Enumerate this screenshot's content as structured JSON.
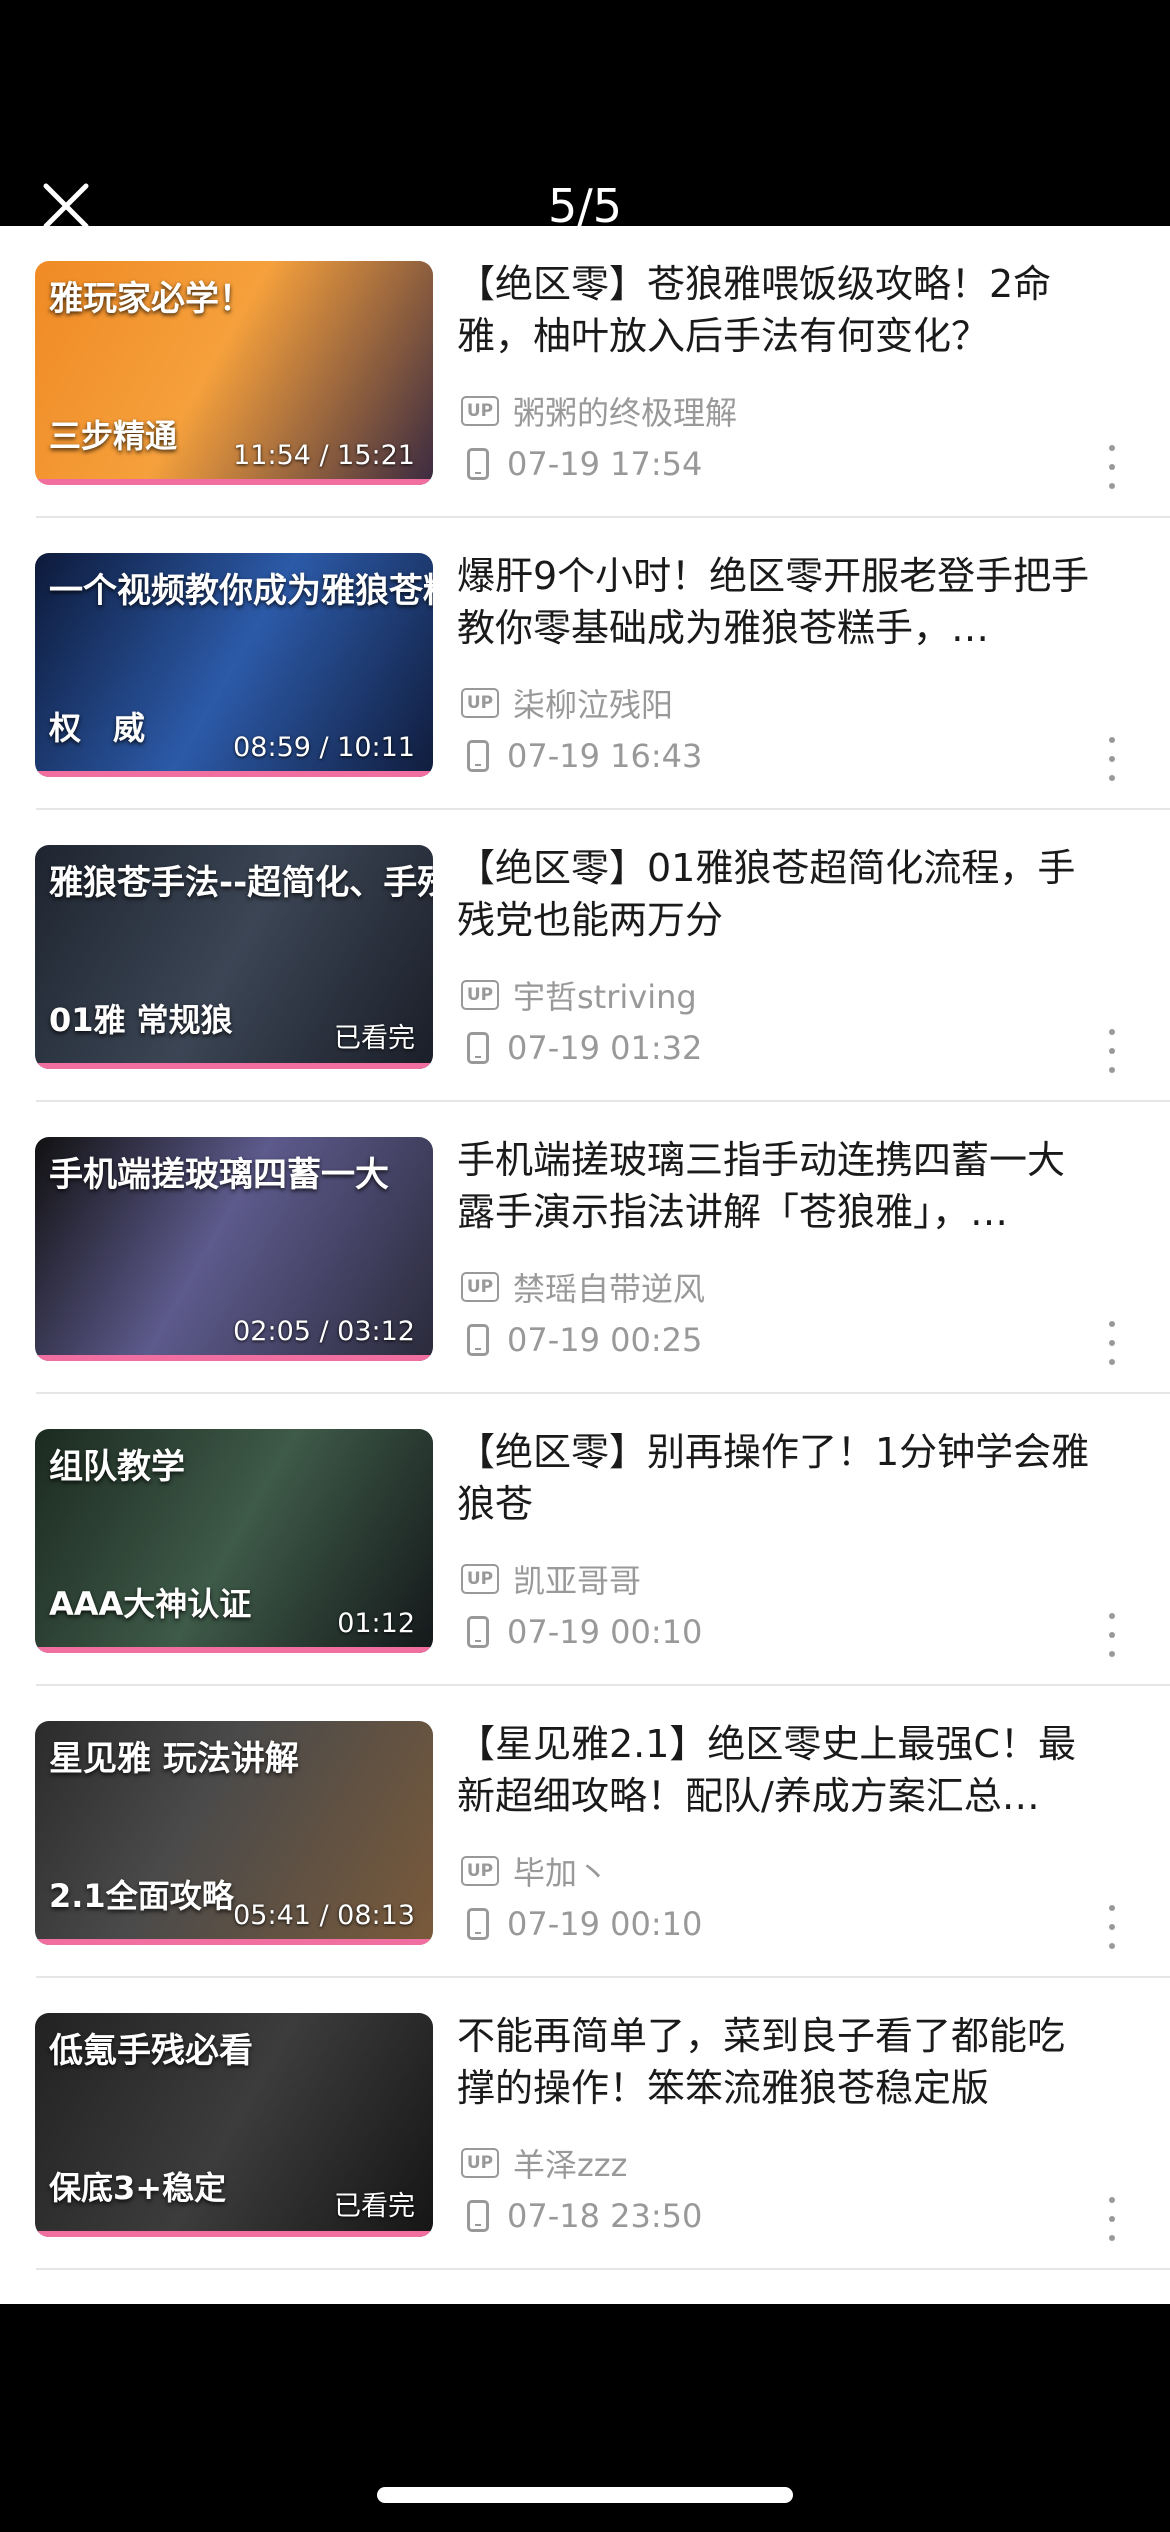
{
  "header": {
    "counter": "5/5"
  },
  "videos": [
    {
      "title": "【绝区零】苍狼雅喂饭级攻略！2命雅，柚叶放入后手法有何变化？",
      "uploader": "粥粥的终极理解",
      "date": "07-19 17:54",
      "duration": "11:54 / 15:21",
      "thumb_top": "雅玩家必学！",
      "thumb_bottom": "三步精通",
      "bg": "linear-gradient(120deg,#f08a24 0%,#f5a03c 45%,#3a2a40 100%)"
    },
    {
      "title": "爆肝9个小时！绝区零开服老登手把手教你零基础成为雅狼苍糕手，…",
      "uploader": "柒柳泣残阳",
      "date": "07-19 16:43",
      "duration": "08:59 / 10:11",
      "thumb_top": "一个视频教你成为雅狼苍糕手!",
      "thumb_bottom": "权　威",
      "bg": "linear-gradient(120deg,#0d1a3a 0%,#2c5aa8 50%,#101c3c 100%)"
    },
    {
      "title": "【绝区零】01雅狼苍超简化流程，手残党也能两万分",
      "uploader": "宇哲striving",
      "date": "07-19 01:32",
      "duration": "已看完",
      "thumb_top": "雅狼苍手法--超简化、手残党",
      "thumb_bottom": "01雅 常规狼",
      "bg": "linear-gradient(120deg,#1e2530 0%,#3b4554 50%,#1a1e28 100%)"
    },
    {
      "title": "手机端搓玻璃三指手动连携四蓄一大露手演示指法讲解「苍狼雅」，…",
      "uploader": "禁瑶自带逆风",
      "date": "07-19 00:25",
      "duration": "02:05 / 03:12",
      "thumb_top": "手机端搓玻璃四蓄一大",
      "thumb_bottom": "",
      "bg": "linear-gradient(120deg,#111 0%,#5d5a8c 45%,#2a2a3a 100%)"
    },
    {
      "title": "【绝区零】别再操作了！1分钟学会雅狼苍",
      "uploader": "凯亚哥哥",
      "date": "07-19 00:10",
      "duration": "01:12",
      "thumb_top": "组队教学",
      "thumb_bottom": "AAA大神认证",
      "bg": "linear-gradient(120deg,#1c2a20 0%,#3e5a48 50%,#14181a 100%)"
    },
    {
      "title": "【星见雅2.1】绝区零史上最强C！最新超细攻略！配队/养成方案汇总…",
      "uploader": "毕加丶",
      "date": "07-19 00:10",
      "duration": "05:41 / 08:13",
      "thumb_top": "星见雅 玩法讲解",
      "thumb_bottom": "2.1全面攻略",
      "bg": "linear-gradient(120deg,#2b2b2b 0%,#4a4a4a 40%,#7a5a3a 100%)"
    },
    {
      "title": "不能再简单了，菜到良子看了都能吃撑的操作！笨笨流雅狼苍稳定版",
      "uploader": "羊泽zzz",
      "date": "07-18 23:50",
      "duration": "已看完",
      "thumb_top": "低氪手残必看",
      "thumb_bottom": "保底3+稳定",
      "bg": "linear-gradient(120deg,#222 0%,#3c3c3c 50%,#151515 100%)"
    }
  ],
  "labels": {
    "up_badge": "UP"
  }
}
